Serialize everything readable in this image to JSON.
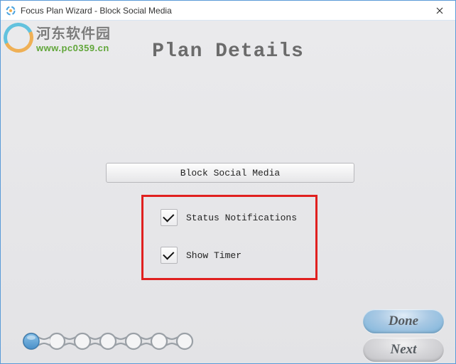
{
  "window": {
    "title": "Focus Plan Wizard - Block Social Media"
  },
  "watermark": {
    "brand": "河东软件园",
    "url": "www.pc0359.cn"
  },
  "heading": "Plan Details",
  "plan": {
    "name_label": "Block Social Media"
  },
  "options": {
    "status_notifications": {
      "label": "Status Notifications",
      "checked": true
    },
    "show_timer": {
      "label": "Show Timer",
      "checked": true
    }
  },
  "buttons": {
    "done": "Done",
    "next": "Next"
  },
  "progress": {
    "current_step": 1,
    "total_steps": 7
  }
}
